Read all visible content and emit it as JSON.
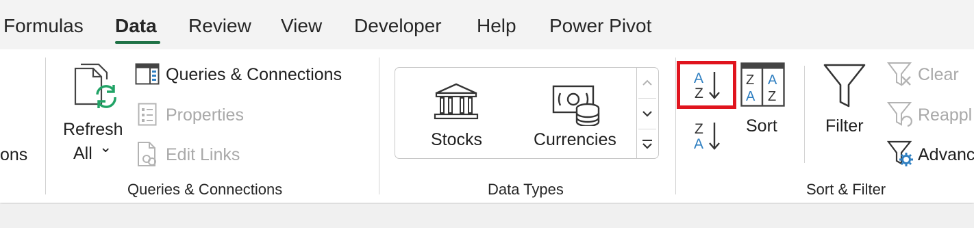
{
  "tabs": [
    {
      "label": "Formulas",
      "active": false
    },
    {
      "label": "Data",
      "active": true
    },
    {
      "label": "Review",
      "active": false
    },
    {
      "label": "View",
      "active": false
    },
    {
      "label": "Developer",
      "active": false
    },
    {
      "label": "Help",
      "active": false
    },
    {
      "label": "Power Pivot",
      "active": false
    }
  ],
  "left_partial": {
    "label": "ons"
  },
  "queries": {
    "refresh_line1": "Refresh",
    "refresh_line2": "All",
    "refresh_chevron": "⌄",
    "queries_connections": "Queries & Connections",
    "properties": "Properties",
    "edit_links": "Edit Links",
    "group_label": "Queries & Connections"
  },
  "data_types": {
    "stocks": "Stocks",
    "currencies": "Currencies",
    "group_label": "Data Types"
  },
  "sort_filter": {
    "sort_az_letters": [
      "A",
      "Z"
    ],
    "sort_za_letters": [
      "Z",
      "A"
    ],
    "sort_label": "Sort",
    "filter_label": "Filter",
    "clear_label": "Clear",
    "reapply_label": "Reappl",
    "advanced_label": "Advanc",
    "group_label": "Sort & Filter"
  },
  "colors": {
    "accent_green": "#1e7145",
    "sort_blue": "#2f7fc1",
    "highlight_red": "#e0141e",
    "disabled": "#a9a9a9"
  }
}
